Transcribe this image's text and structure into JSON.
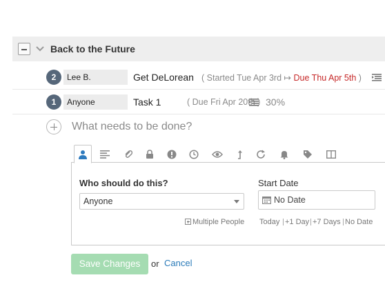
{
  "group": {
    "title": "Back to the Future",
    "collapse_icon": "minus-icon",
    "chevron_icon": "chevron-down-icon"
  },
  "tasks": [
    {
      "number": "2",
      "assignee": "Lee B.",
      "name": "Get DeLorean",
      "meta_prefix": "( Started Tue Apr 3rd",
      "arrow": "↦",
      "meta_due": "Due Thu Apr 5th",
      "meta_suffix": ")",
      "has_description": true
    },
    {
      "number": "1",
      "assignee": "Anyone",
      "name": "Task 1",
      "meta": "( Due Fri Apr 20th )",
      "has_description": true,
      "progress": "30%"
    }
  ],
  "new_task": {
    "placeholder": "What needs to be done?"
  },
  "tabs": [
    "person-icon",
    "description-icon",
    "attachment-icon",
    "lock-icon",
    "priority-icon",
    "clock-icon",
    "watch-icon",
    "dependency-icon",
    "repeat-icon",
    "bell-icon",
    "tag-icon",
    "column-icon"
  ],
  "form": {
    "assignee_label": "Who should do this?",
    "assignee_value": "Anyone",
    "multiple_people": "Multiple People",
    "start_label": "Start Date",
    "start_value": "No Date",
    "quick_dates": [
      "Today",
      "+1 Day",
      "+7 Days",
      "No Date"
    ]
  },
  "actions": {
    "save": "Save Changes",
    "or": "or",
    "cancel": "Cancel"
  },
  "colors": {
    "badge": "#56677a",
    "due_red": "#c62828",
    "save_green": "#a5dcb2",
    "link_blue": "#2b7bb9"
  }
}
